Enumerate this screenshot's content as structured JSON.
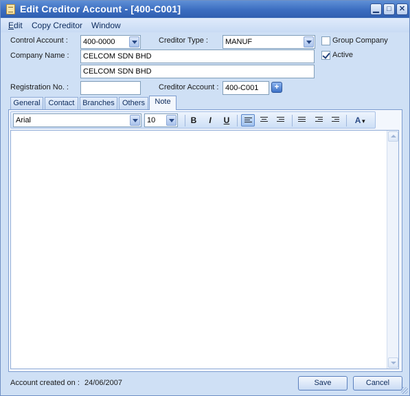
{
  "window": {
    "title": "Edit Creditor Account - [400-C001]"
  },
  "menu": {
    "items": [
      {
        "first": "E",
        "rest": "dit"
      },
      {
        "first": "",
        "rest": "Copy Creditor"
      },
      {
        "first": "",
        "rest": "Window"
      }
    ]
  },
  "form": {
    "control_account_label": "Control Account :",
    "control_account_value": "400-0000",
    "creditor_type_label": "Creditor Type :",
    "creditor_type_value": "MANUF",
    "group_company_label": "Group Company",
    "group_company_checked": false,
    "active_label": "Active",
    "active_checked": true,
    "company_name_label": "Company Name :",
    "company_name_1": "CELCOM SDN BHD",
    "company_name_2": "CELCOM SDN BHD",
    "registration_label": "Registration No. :",
    "registration_value": "",
    "creditor_account_label": "Creditor Account :",
    "creditor_account_value": "400-C001"
  },
  "tabs": [
    {
      "label": "General",
      "active": false
    },
    {
      "label": "Contact",
      "active": false
    },
    {
      "label": "Branches",
      "active": false
    },
    {
      "label": "Others",
      "active": false
    },
    {
      "label": "Note",
      "active": true
    }
  ],
  "editor": {
    "font": "Arial",
    "size": "10",
    "bold": "B",
    "italic": "I",
    "underline": "U",
    "content": ""
  },
  "footer": {
    "created_label": "Account created on :",
    "created_date": "24/06/2007",
    "save": "Save",
    "cancel": "Cancel"
  },
  "colors": {
    "titlebar": "#3b6dc0",
    "window_bg": "#cfe0f5"
  }
}
